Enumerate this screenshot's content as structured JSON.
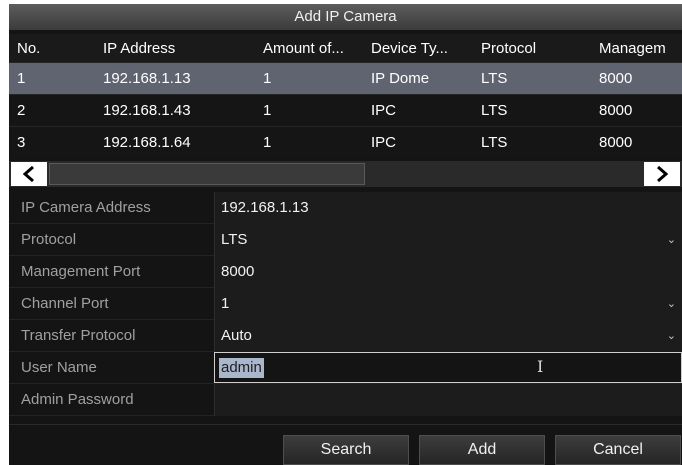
{
  "dialog": {
    "title": "Add IP Camera"
  },
  "table": {
    "headers": [
      "No.",
      "IP Address",
      "Amount of...",
      "Device Ty...",
      "Protocol",
      "Managem"
    ],
    "rows": [
      [
        "1",
        "192.168.1.13",
        "1",
        "IP Dome",
        "LTS",
        "8000"
      ],
      [
        "2",
        "192.168.1.43",
        "1",
        "IPC",
        "LTS",
        "8000"
      ],
      [
        "3",
        "192.168.1.64",
        "1",
        "IPC",
        "LTS",
        "8000"
      ]
    ],
    "selected_row": 1
  },
  "scrollbar": {
    "left_icon": "chevron-left-icon",
    "right_icon": "chevron-right-icon"
  },
  "form": {
    "ip_label": "IP Camera Address",
    "ip_value": "192.168.1.13",
    "protocol_label": "Protocol",
    "protocol_value": "LTS",
    "mgmt_port_label": "Management Port",
    "mgmt_port_value": "8000",
    "channel_port_label": "Channel Port",
    "channel_port_value": "1",
    "transfer_label": "Transfer Protocol",
    "transfer_value": "Auto",
    "username_label": "User Name",
    "username_value": "admin",
    "password_label": "Admin Password",
    "password_value": ""
  },
  "buttons": {
    "search": "Search",
    "add": "Add",
    "cancel": "Cancel"
  },
  "colors": {
    "selected_row": "#5f6470",
    "background": "#141414",
    "text_selection": "#aab6cc"
  }
}
